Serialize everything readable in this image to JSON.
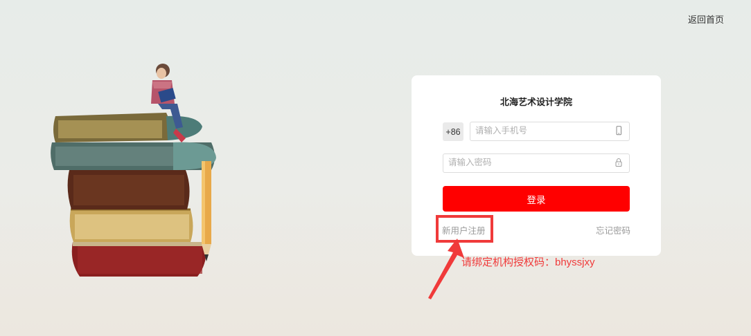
{
  "header": {
    "home_link": "返回首页"
  },
  "login": {
    "title": "北海艺术设计学院",
    "country_code": "+86",
    "phone_placeholder": "请输入手机号",
    "password_placeholder": "请输入密码",
    "login_button": "登录",
    "register_link": "新用户注册",
    "forgot_link": "忘记密码"
  },
  "annotation": {
    "text": "请绑定机构授权码：bhyssjxy"
  },
  "icons": {
    "phone": "mobile-phone-icon",
    "password": "lock-icon",
    "arrow": "annotation-arrow"
  },
  "colors": {
    "primary": "#ff0000",
    "annotation": "#f03a3a",
    "background": "#e9ece8"
  }
}
